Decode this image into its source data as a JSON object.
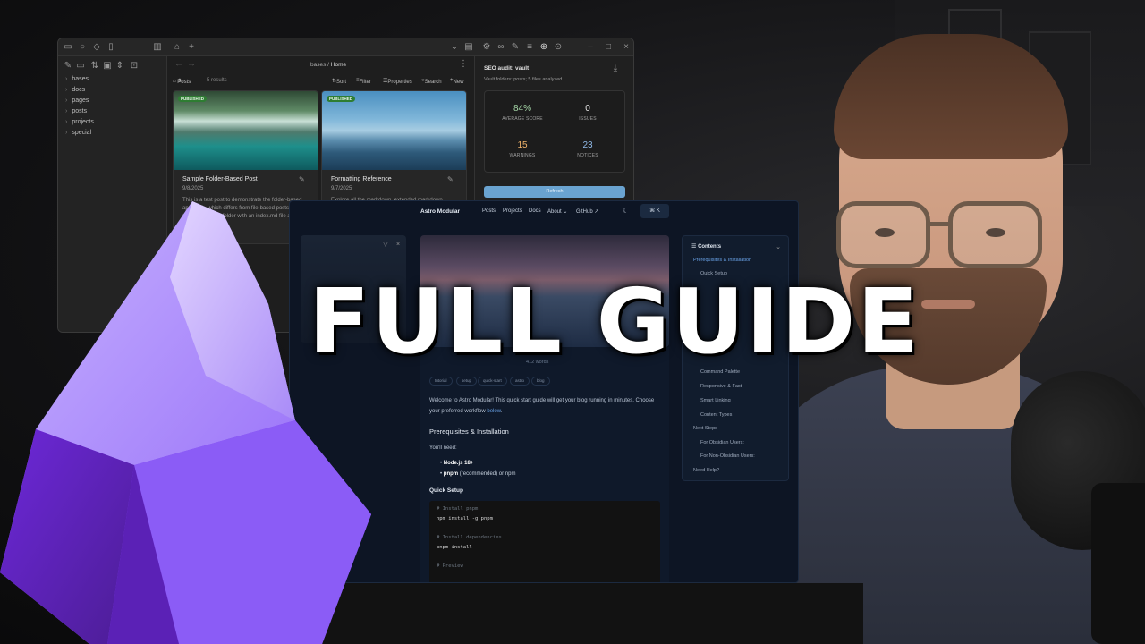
{
  "headline": "FULL GUIDE",
  "obsidian": {
    "breadcrumb_folder": "bases",
    "breadcrumb_sep": "/",
    "breadcrumb_page": "Home",
    "view_name": "Posts",
    "results": "5 results",
    "toolbar": {
      "sort": "Sort",
      "filter": "Filter",
      "properties": "Properties",
      "search": "Search",
      "new": "New"
    },
    "folders": [
      "bases",
      "docs",
      "pages",
      "posts",
      "projects",
      "special"
    ],
    "cards": [
      {
        "badge": "PUBLISHED",
        "title": "Sample Folder-Based Post",
        "date": "9/8/2025",
        "desc": "This is a test post to demonstrate the folder-based approach, which differs from file-based posts. Each post has its own folder with an index.md file and a folder name a"
      },
      {
        "badge": "PUBLISHED",
        "title": "Formatting Reference",
        "date": "9/7/2025",
        "desc": "Explore all the markdown, extended markdown,"
      }
    ],
    "seo": {
      "title": "SEO audit: vault",
      "subtitle": "Vault folders: posts; 5 files analyzed",
      "average_score": "84%",
      "average_score_label": "AVERAGE SCORE",
      "issues": "0",
      "issues_label": "ISSUES",
      "warnings": "15",
      "warnings_label": "WARNINGS",
      "notices": "23",
      "notices_label": "NOTICES",
      "refresh": "Refresh"
    }
  },
  "site": {
    "brand": "Astro Modular",
    "nav": [
      "Posts",
      "Projects",
      "Docs",
      "About",
      "GitHub"
    ],
    "search_key": "⌘",
    "search_shortcut": "K",
    "meta_words": "412 words",
    "tags": [
      "tutorial",
      "setup",
      "quick-start",
      "astro",
      "blog"
    ],
    "intro_pre": "Welcome to Astro Modular! This quick start guide will get your blog running in minutes. Choose your preferred workflow ",
    "intro_link": "below",
    "intro_post": ".",
    "h_prereq": "Prerequisites & Installation",
    "youll_need": "You'll need:",
    "req1": "Node.js 18+",
    "req2_bold": "pnpm",
    "req2_rest": " (recommended) or npm",
    "h_quick": "Quick Setup",
    "code": [
      "# Install pnpm",
      "npm install -g pnpm",
      "",
      "# Install dependencies",
      "pnpm install",
      "",
      "# Preview"
    ],
    "toc_title": "Contents",
    "toc": [
      "Prerequisites & Installation",
      "Quick Setup",
      "Command Palette",
      "Responsive & Fast",
      "Smart Linking",
      "Content Types",
      "Next Steps",
      "For Obsidian Users:",
      "For Non-Obsidian Users:",
      "Need Help?"
    ]
  },
  "colors": {
    "obsidian_purple": "#7c3aed",
    "published_badge": "#2e7d32",
    "score_green": "#a5d6a7",
    "warning_orange": "#f0b36a",
    "notice_blue": "#8fb8e6",
    "link_blue": "#6aa3e8"
  }
}
